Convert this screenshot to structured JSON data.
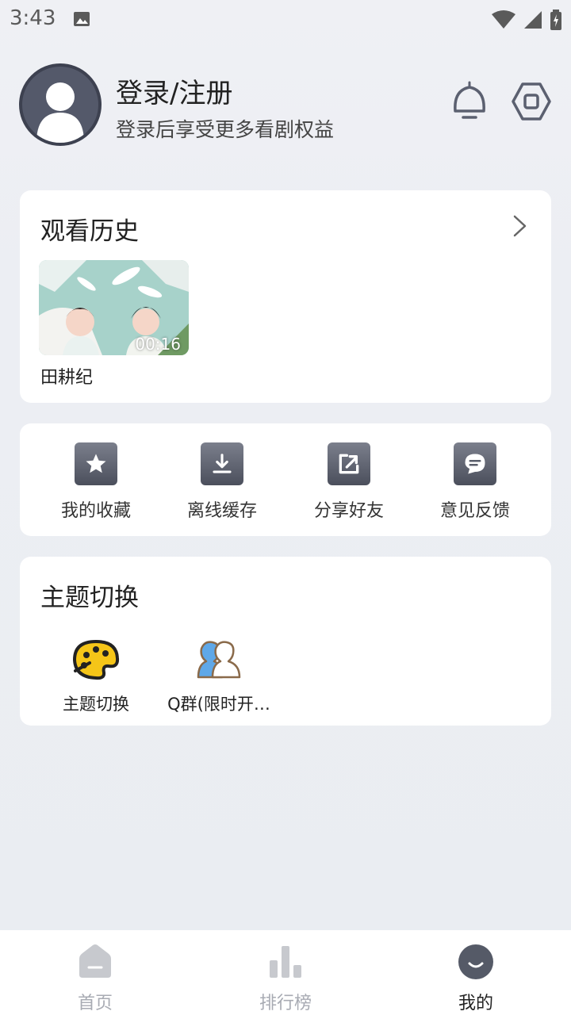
{
  "status": {
    "time": "3:43"
  },
  "profile": {
    "title": "登录/注册",
    "subtitle": "登录后享受更多看剧权益",
    "icons": [
      "avatar-icon",
      "bell-icon",
      "settings-icon"
    ]
  },
  "history": {
    "title": "观看历史",
    "items": [
      {
        "name": "田耕纪",
        "duration": "00:16"
      }
    ]
  },
  "actions": [
    {
      "label": "我的收藏",
      "icon": "star-icon"
    },
    {
      "label": "离线缓存",
      "icon": "download-icon"
    },
    {
      "label": "分享好友",
      "icon": "share-icon"
    },
    {
      "label": "意见反馈",
      "icon": "feedback-icon"
    }
  ],
  "theme": {
    "title": "主题切换",
    "items": [
      {
        "label": "主题切换",
        "icon": "palette-icon"
      },
      {
        "label": "Q群(限时开…",
        "icon": "group-icon"
      }
    ]
  },
  "nav": [
    {
      "label": "首页",
      "icon": "home-icon",
      "active": false
    },
    {
      "label": "排行榜",
      "icon": "rank-icon",
      "active": false
    },
    {
      "label": "我的",
      "icon": "profile-icon",
      "active": true
    }
  ],
  "colors": {
    "accent": "#4b4f5c",
    "inactive": "#a8abb3",
    "background": "#eceef3"
  }
}
